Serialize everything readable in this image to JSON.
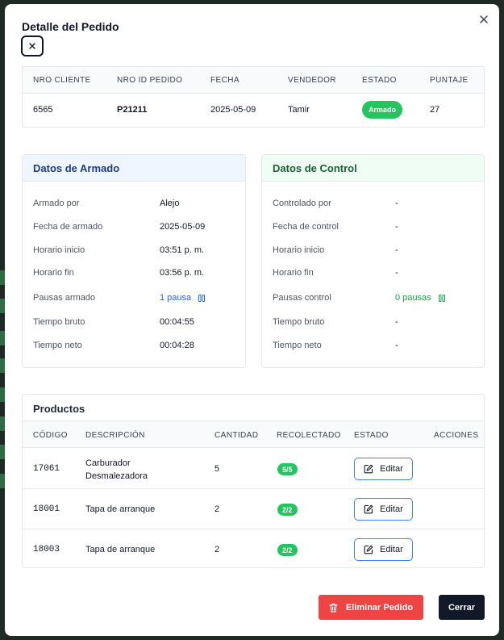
{
  "modal": {
    "title": "Detalle del Pedido"
  },
  "order": {
    "headers": [
      "NRO CLIENTE",
      "NRO ID PEDIDO",
      "FECHA",
      "VENDEDOR",
      "ESTADO",
      "PUNTAJE"
    ],
    "cliente": "6565",
    "pedido_id": "P21211",
    "fecha": "2025-05-09",
    "vendedor": "Tamir",
    "estado": "Armado",
    "puntaje": "27"
  },
  "armado": {
    "title": "Datos de Armado",
    "rows": [
      {
        "label": "Armado por",
        "value": "Alejo"
      },
      {
        "label": "Fecha de armado",
        "value": "2025-05-09"
      },
      {
        "label": "Horario inicio",
        "value": "03:51 p. m."
      },
      {
        "label": "Horario fin",
        "value": "03:56 p. m."
      },
      {
        "label": "Pausas armado",
        "value": "1 pausa"
      },
      {
        "label": "Tiempo bruto",
        "value": "00:04:55"
      },
      {
        "label": "Tiempo neto",
        "value": "00:04:28"
      }
    ]
  },
  "control": {
    "title": "Datos de Control",
    "rows": [
      {
        "label": "Controlado por",
        "value": "-"
      },
      {
        "label": "Fecha de control",
        "value": "-"
      },
      {
        "label": "Horario inicio",
        "value": "-"
      },
      {
        "label": "Horario fin",
        "value": "-"
      },
      {
        "label": "Pausas control",
        "value": "0 pausas"
      },
      {
        "label": "Tiempo bruto",
        "value": "-"
      },
      {
        "label": "Tiempo neto",
        "value": "-"
      }
    ]
  },
  "products": {
    "title": "Productos",
    "headers": [
      "CÓDIGO",
      "DESCRIPCIÓN",
      "CANTIDAD",
      "RECOLECTADO",
      "ESTADO",
      "ACCIONES"
    ],
    "rows": [
      {
        "codigo": "17061",
        "descripcion": "Carburador Desmalezadora",
        "cantidad": "5",
        "recolectado": "5/5",
        "accion": "Editar"
      },
      {
        "codigo": "18001",
        "descripcion": "Tapa de arranque",
        "cantidad": "2",
        "recolectado": "2/2",
        "accion": "Editar"
      },
      {
        "codigo": "18003",
        "descripcion": "Tapa de arranque",
        "cantidad": "2",
        "recolectado": "2/2",
        "accion": "Editar"
      }
    ]
  },
  "actions": {
    "delete_label": "Eliminar Pedido",
    "close_label": "Cerrar"
  },
  "colors": {
    "success": "#22c55e",
    "danger": "#ef4444",
    "primary_dark": "#111827",
    "link_blue": "#2563eb",
    "link_green": "#16a34a"
  },
  "icons": {
    "close": "close-icon",
    "pause": "pause-icon",
    "edit": "edit-icon",
    "trash": "trash-icon"
  }
}
